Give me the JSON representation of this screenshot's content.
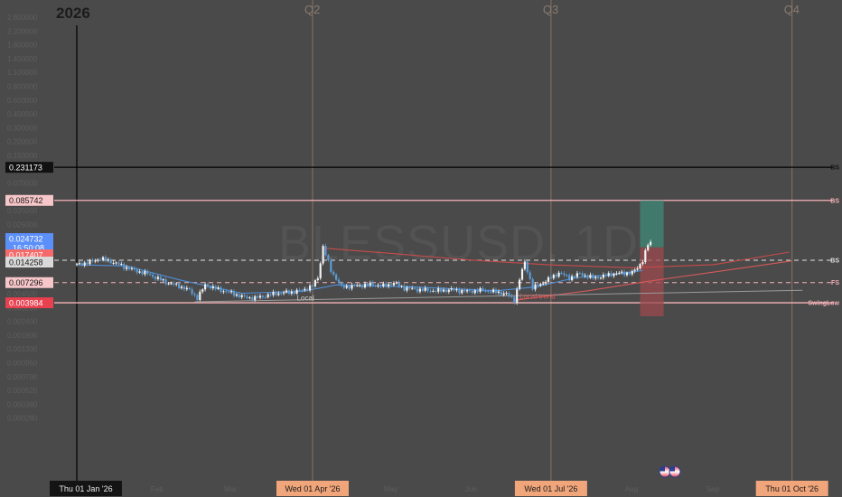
{
  "symbol_watermark": "BLESSUSD, 1D",
  "year_label": "2026",
  "quarters": [
    {
      "label": "Q2",
      "date": "2026-04-01"
    },
    {
      "label": "Q3",
      "date": "2026-07-01"
    },
    {
      "label": "Q4",
      "date": "2026-10-01"
    }
  ],
  "x_tags": [
    {
      "text": "Thu 01 Jan '26",
      "date": "2026-01-01",
      "style": "dark"
    },
    {
      "text": "Wed 01 Apr '26",
      "date": "2026-04-01",
      "style": "orange"
    },
    {
      "text": "Wed 01 Jul '26",
      "date": "2026-07-01",
      "style": "orange"
    },
    {
      "text": "Thu 01 Oct '26",
      "date": "2026-10-01",
      "style": "orange"
    }
  ],
  "month_ticks": [
    {
      "text": "Feb",
      "date": "2026-02-01"
    },
    {
      "text": "Mar",
      "date": "2026-03-01"
    },
    {
      "text": "May",
      "date": "2026-05-01"
    },
    {
      "text": "Jun",
      "date": "2026-06-01"
    },
    {
      "text": "Aug",
      "date": "2026-08-01"
    },
    {
      "text": "Sep",
      "date": "2026-09-01"
    }
  ],
  "y_ticks": [
    "2.600000",
    "2.200000",
    "1.800000",
    "1.400000",
    "1.100000",
    "0.800000",
    "0.600000",
    "0.400000",
    "0.300000",
    "0.200000",
    "0.150000",
    "0.100000",
    "0.070000",
    "0.050000",
    "0.035000",
    "0.025000",
    "0.018000",
    "0.012000",
    "0.009000",
    "0.006000",
    "0.004500",
    "0.003200",
    "0.002400",
    "0.001800",
    "0.001300",
    "0.000950",
    "0.000700",
    "0.000520",
    "0.000380",
    "0.000280"
  ],
  "price_tags": [
    {
      "text": "0.231173",
      "price": 0.231173,
      "bg": "#111111",
      "fg": "#ffffff"
    },
    {
      "text": "0.085742",
      "price": 0.085742,
      "bg": "#f7c6c9",
      "fg": "#1a1a1a"
    },
    {
      "text": "0.024732",
      "price": 0.024732,
      "bg": "#5b8ff9",
      "fg": "#ffffff"
    },
    {
      "text": "16:50:08",
      "price": 0.021,
      "bg": "#5b8ff9",
      "fg": "#ffffff"
    },
    {
      "text": "0.017407",
      "price": 0.017407,
      "bg": "#f56a6a",
      "fg": "#ffffff"
    },
    {
      "text": "0.014258",
      "price": 0.014258,
      "bg": "#d9d9d9",
      "fg": "#1a1a1a"
    },
    {
      "text": "0.007296",
      "price": 0.007296,
      "bg": "#f7c6c9",
      "fg": "#1a1a1a"
    },
    {
      "text": "0.003984",
      "price": 0.003984,
      "bg": "#e8404f",
      "fg": "#ffffff"
    }
  ],
  "levels": [
    {
      "label": "BS",
      "price": 0.231173,
      "color": "#000000",
      "style": "solid"
    },
    {
      "label": "BS",
      "price": 0.085742,
      "color": "#f7b3b8",
      "style": "solid"
    },
    {
      "label": "BS",
      "price": 0.014258,
      "color": "#e0e0e0",
      "style": "dashed"
    },
    {
      "label": "FS",
      "price": 0.007296,
      "color": "#f7b3b8",
      "style": "dashed"
    },
    {
      "label": "SwingLow",
      "price": 0.003984,
      "color": "#f7b3b8",
      "style": "solid"
    }
  ],
  "annotations": [
    {
      "text": "Local",
      "date": "2026-03-26",
      "price": 0.0043,
      "color": "#cfcfcf"
    },
    {
      "text": "Local trend",
      "date": "2026-06-19",
      "price": 0.0045,
      "color": "#e05858"
    }
  ],
  "position_box": {
    "date_start": "2026-08-04",
    "date_end": "2026-08-13",
    "entry": 0.021,
    "target": 0.085742,
    "stop": 0.0024
  },
  "colors": {
    "background": "#4a4a4a",
    "up": "#f2f2f2",
    "down": "#5b9bd5",
    "accent": "#5b8ff9",
    "swing": "#e8404f",
    "profit": "#3f8a7a",
    "loss": "#9c4a4e"
  },
  "event_icons": [
    "us-flag-icon",
    "us-flag-icon"
  ],
  "chart_data": {
    "type": "candlestick",
    "symbol": "BLESSUSD",
    "timeframe": "1D",
    "y_scale": "log",
    "ylim": [
      0.00028,
      2.6
    ],
    "xlim": [
      "2025-12-31",
      "2026-10-05"
    ],
    "grid": false,
    "legend": "none",
    "series": [
      {
        "type": "candles",
        "key": "close",
        "anchors": [
          [
            "2026-01-01",
            0.0125
          ],
          [
            "2026-01-06",
            0.0135
          ],
          [
            "2026-01-10",
            0.015
          ],
          [
            "2026-01-14",
            0.0138
          ],
          [
            "2026-01-19",
            0.0118
          ],
          [
            "2026-01-23",
            0.0105
          ],
          [
            "2026-01-28",
            0.0095
          ],
          [
            "2026-02-01",
            0.0082
          ],
          [
            "2026-02-05",
            0.0072
          ],
          [
            "2026-02-09",
            0.0066
          ],
          [
            "2026-02-13",
            0.0058
          ],
          [
            "2026-02-16",
            0.0046
          ],
          [
            "2026-02-19",
            0.0068
          ],
          [
            "2026-02-23",
            0.0061
          ],
          [
            "2026-03-02",
            0.0052
          ],
          [
            "2026-03-06",
            0.0047
          ],
          [
            "2026-03-10",
            0.0046
          ],
          [
            "2026-03-14",
            0.0049
          ],
          [
            "2026-03-18",
            0.0053
          ],
          [
            "2026-03-24",
            0.0055
          ],
          [
            "2026-03-28",
            0.0058
          ],
          [
            "2026-04-01",
            0.0066
          ],
          [
            "2026-04-03",
            0.0085
          ],
          [
            "2026-04-05",
            0.0215
          ],
          [
            "2026-04-08",
            0.0105
          ],
          [
            "2026-04-12",
            0.0064
          ],
          [
            "2026-04-17",
            0.0066
          ],
          [
            "2026-04-23",
            0.0069
          ],
          [
            "2026-04-28",
            0.0066
          ],
          [
            "2026-05-02",
            0.0072
          ],
          [
            "2026-05-06",
            0.0062
          ],
          [
            "2026-05-12",
            0.0059
          ],
          [
            "2026-05-18",
            0.0057
          ],
          [
            "2026-05-24",
            0.0059
          ],
          [
            "2026-05-30",
            0.0056
          ],
          [
            "2026-06-05",
            0.0058
          ],
          [
            "2026-06-10",
            0.0055
          ],
          [
            "2026-06-14",
            0.0052
          ],
          [
            "2026-06-17",
            0.0043
          ],
          [
            "2026-06-19",
            0.0081
          ],
          [
            "2026-06-21",
            0.0135
          ],
          [
            "2026-06-24",
            0.0062
          ],
          [
            "2026-06-28",
            0.0073
          ],
          [
            "2026-07-04",
            0.0098
          ],
          [
            "2026-07-08",
            0.0084
          ],
          [
            "2026-07-12",
            0.0095
          ],
          [
            "2026-07-17",
            0.0084
          ],
          [
            "2026-07-21",
            0.0088
          ],
          [
            "2026-07-24",
            0.0095
          ],
          [
            "2026-07-28",
            0.0097
          ],
          [
            "2026-08-01",
            0.0098
          ],
          [
            "2026-08-03",
            0.0114
          ],
          [
            "2026-08-05",
            0.0143
          ],
          [
            "2026-08-07",
            0.0228
          ],
          [
            "2026-08-08",
            0.0247
          ]
        ]
      },
      {
        "type": "line",
        "key": "moving_average",
        "points": [
          [
            "2026-01-01",
            0.0125
          ],
          [
            "2026-01-20",
            0.012
          ],
          [
            "2026-02-10",
            0.0078
          ],
          [
            "2026-03-05",
            0.0053
          ],
          [
            "2026-03-28",
            0.0056
          ],
          [
            "2026-04-10",
            0.0068
          ],
          [
            "2026-05-10",
            0.0064
          ],
          [
            "2026-06-10",
            0.0057
          ],
          [
            "2026-06-25",
            0.0064
          ],
          [
            "2026-07-10",
            0.0084
          ],
          [
            "2026-07-25",
            0.0093
          ],
          [
            "2026-08-05",
            0.0105
          ]
        ]
      },
      {
        "type": "line",
        "key": "trend_curve",
        "points": [
          [
            "2026-04-05",
            0.0205
          ],
          [
            "2026-05-01",
            0.0175
          ],
          [
            "2026-06-01",
            0.0143
          ],
          [
            "2026-07-01",
            0.0124
          ],
          [
            "2026-08-01",
            0.0114
          ],
          [
            "2026-09-01",
            0.0125
          ],
          [
            "2026-09-30",
            0.0182
          ]
        ]
      },
      {
        "type": "line",
        "key": "local_trend",
        "points": [
          [
            "2026-06-17",
            0.0043
          ],
          [
            "2026-07-15",
            0.0057
          ],
          [
            "2026-08-05",
            0.0074
          ],
          [
            "2026-09-15",
            0.0117
          ],
          [
            "2026-10-01",
            0.014
          ]
        ]
      },
      {
        "type": "line",
        "key": "local_support",
        "points": [
          [
            "2026-02-15",
            0.0041
          ],
          [
            "2026-10-05",
            0.0058
          ]
        ]
      }
    ]
  }
}
